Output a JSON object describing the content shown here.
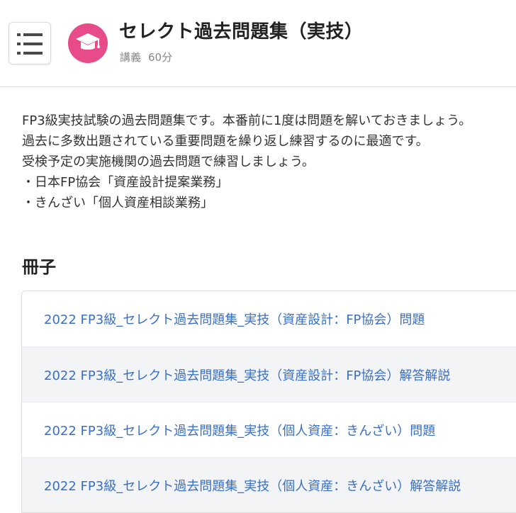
{
  "header": {
    "title": "セレクト過去問題集（実技）",
    "meta_type": "講義",
    "meta_duration": "60分",
    "icons": {
      "menu": "hamburger-menu-icon",
      "course": "graduation-cap-icon"
    },
    "colors": {
      "course_icon_bg": "#e84b8a",
      "link": "#3a6fc4"
    }
  },
  "description": {
    "lines": [
      "FP3級実技試験の過去問題集です。本番前に1度は問題を解いておきましょう。",
      "過去に多数出題されている重要問題を繰り返し練習するのに最適です。",
      "受検予定の実施機関の過去問題で練習しましょう。",
      "・日本FP協会「資産設計提案業務」",
      "・きんざい「個人資産相談業務」"
    ]
  },
  "booklets": {
    "heading": "冊子",
    "items": [
      "2022 FP3級_セレクト過去問題集_実技（資産設計：FP協会）問題",
      "2022 FP3級_セレクト過去問題集_実技（資産設計：FP協会）解答解説",
      "2022 FP3級_セレクト過去問題集_実技（個人資産：きんざい）問題",
      "2022 FP3級_セレクト過去問題集_実技（個人資産：きんざい）解答解説"
    ]
  }
}
